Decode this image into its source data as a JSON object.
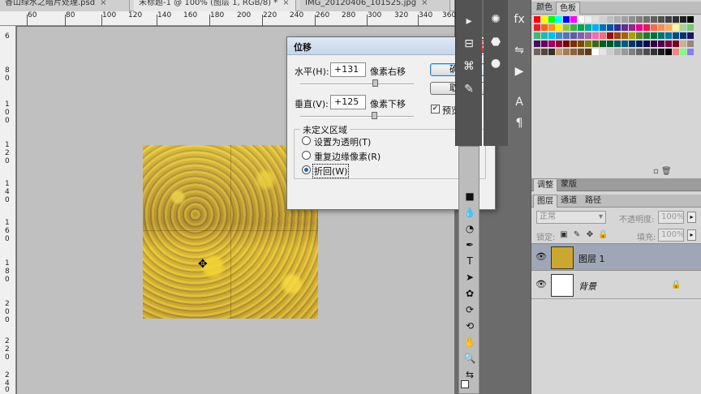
{
  "doc_tabs": [
    {
      "label": "香山绿水之暗片处理.psd",
      "active": false
    },
    {
      "label": "未标题-1 @ 100% (图层 1, RGB/8) *",
      "active": true
    },
    {
      "label": "IMG_20120406_101525.jpg",
      "active": false
    }
  ],
  "ruler_top_labels": [
    "60",
    "80",
    "100",
    "120",
    "140",
    "160",
    "180",
    "200",
    "220",
    "240",
    "260",
    "280",
    "300",
    "320",
    "340",
    "360"
  ],
  "ruler_left_labels": [
    "6",
    "8",
    "0",
    "1",
    "0",
    "0",
    "1",
    "2",
    "0",
    "1",
    "4",
    "0",
    "1",
    "6",
    "0",
    "1",
    "8",
    "0",
    "2",
    "0",
    "0",
    "2",
    "2",
    "0",
    "2",
    "4",
    "0"
  ],
  "dialog": {
    "title": "位移",
    "horizontal_label": "水平(H):",
    "horizontal_value": "+131",
    "horizontal_unit": "像素右移",
    "vertical_label": "垂直(V):",
    "vertical_value": "+125",
    "vertical_unit": "像素下移",
    "ok_label": "确定",
    "cancel_label": "取消",
    "preview_label": "预览(P)",
    "preview_checked": true,
    "undefined_area_label": "未定义区域",
    "options": [
      {
        "label": "设置为透明(T)",
        "selected": false
      },
      {
        "label": "重复边缘像素(R)",
        "selected": false
      },
      {
        "label": "折回(W)",
        "selected": true
      }
    ]
  },
  "swatches_panel": {
    "tabs": [
      "颜色",
      "色板"
    ],
    "active_tab": "色板",
    "colors": [
      "#ff0000",
      "#ffff00",
      "#00ff00",
      "#00ffff",
      "#0000ff",
      "#ff00ff",
      "#ffffff",
      "#f0f0f0",
      "#e0e0e0",
      "#d0d0d0",
      "#c0c0c0",
      "#b0b0b0",
      "#a0a0a0",
      "#909090",
      "#808080",
      "#707070",
      "#606060",
      "#505050",
      "#404040",
      "#303030",
      "#202020",
      "#000000",
      "#ee1d24",
      "#f26522",
      "#f7941d",
      "#fff200",
      "#8dc63f",
      "#39b54a",
      "#00a651",
      "#00a99d",
      "#00aeef",
      "#0072bc",
      "#0054a6",
      "#2e3192",
      "#662d91",
      "#92278f",
      "#ec008c",
      "#ed145b",
      "#f26c4f",
      "#f68e56",
      "#fbaf5d",
      "#fff799",
      "#a3d39c",
      "#7cc576",
      "#3cb878",
      "#1cbbb4",
      "#00bff3",
      "#448ccb",
      "#5674b9",
      "#605ca8",
      "#8560a8",
      "#a864a8",
      "#f06eaa",
      "#f26d7d",
      "#9e0b0f",
      "#a0410d",
      "#a36209",
      "#aba000",
      "#598527",
      "#1a7b30",
      "#007236",
      "#00746b",
      "#0076a3",
      "#004a80",
      "#003471",
      "#1b1464",
      "#440e62",
      "#630460",
      "#9e005d",
      "#9e0039",
      "#790000",
      "#7b2e00",
      "#7d4900",
      "#827b00",
      "#406618",
      "#005e20",
      "#005826",
      "#005952",
      "#005b7f",
      "#003663",
      "#002157",
      "#0d004c",
      "#32004b",
      "#4b0049",
      "#7b0046",
      "#7a0026",
      "#c7b299",
      "#998675",
      "#736357",
      "#534741",
      "#37302a",
      "#c69c6d",
      "#a67c52",
      "#8c6239",
      "#754c24",
      "#603913",
      "#ffffff",
      "#e5e5e5",
      "#cccccc",
      "#b3b3b3",
      "#999999",
      "#808080",
      "#666666",
      "#4d4d4d",
      "#333333",
      "#1a1a1a",
      "#000000",
      "#ff7f7f",
      "#7fff7f",
      "#7f7fff"
    ]
  },
  "adjust_tabs": [
    "调整",
    "蒙版"
  ],
  "layer_tabs": [
    "图层",
    "通道",
    "路径"
  ],
  "layers_panel": {
    "blend_mode": "正常",
    "opacity_label": "不透明度:",
    "opacity_value": "100%",
    "lock_label": "锁定:",
    "fill_label": "填充:",
    "fill_value": "100%",
    "layers": [
      {
        "name": "图层 1",
        "selected": true
      },
      {
        "name": "背景",
        "selected": false
      }
    ]
  }
}
